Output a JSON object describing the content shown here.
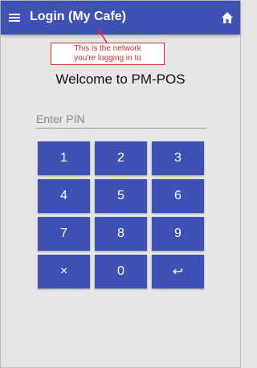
{
  "app_bar": {
    "title": "Login (My Cafe)",
    "menu_icon": "menu-icon",
    "home_icon": "home-icon",
    "color": "#3f51b5"
  },
  "callout": {
    "line1": "This is the network",
    "line2": "you're logging in to",
    "color": "#d32f2f"
  },
  "welcome": "Welcome to PM-POS",
  "pin_field": {
    "placeholder": "Enter PIN",
    "value": ""
  },
  "keypad": {
    "rows": [
      [
        "1",
        "2",
        "3"
      ],
      [
        "4",
        "5",
        "6"
      ],
      [
        "7",
        "8",
        "9"
      ],
      [
        "×",
        "0",
        "↩"
      ]
    ],
    "clear_icon": "clear-icon",
    "enter_icon": "enter-icon"
  }
}
